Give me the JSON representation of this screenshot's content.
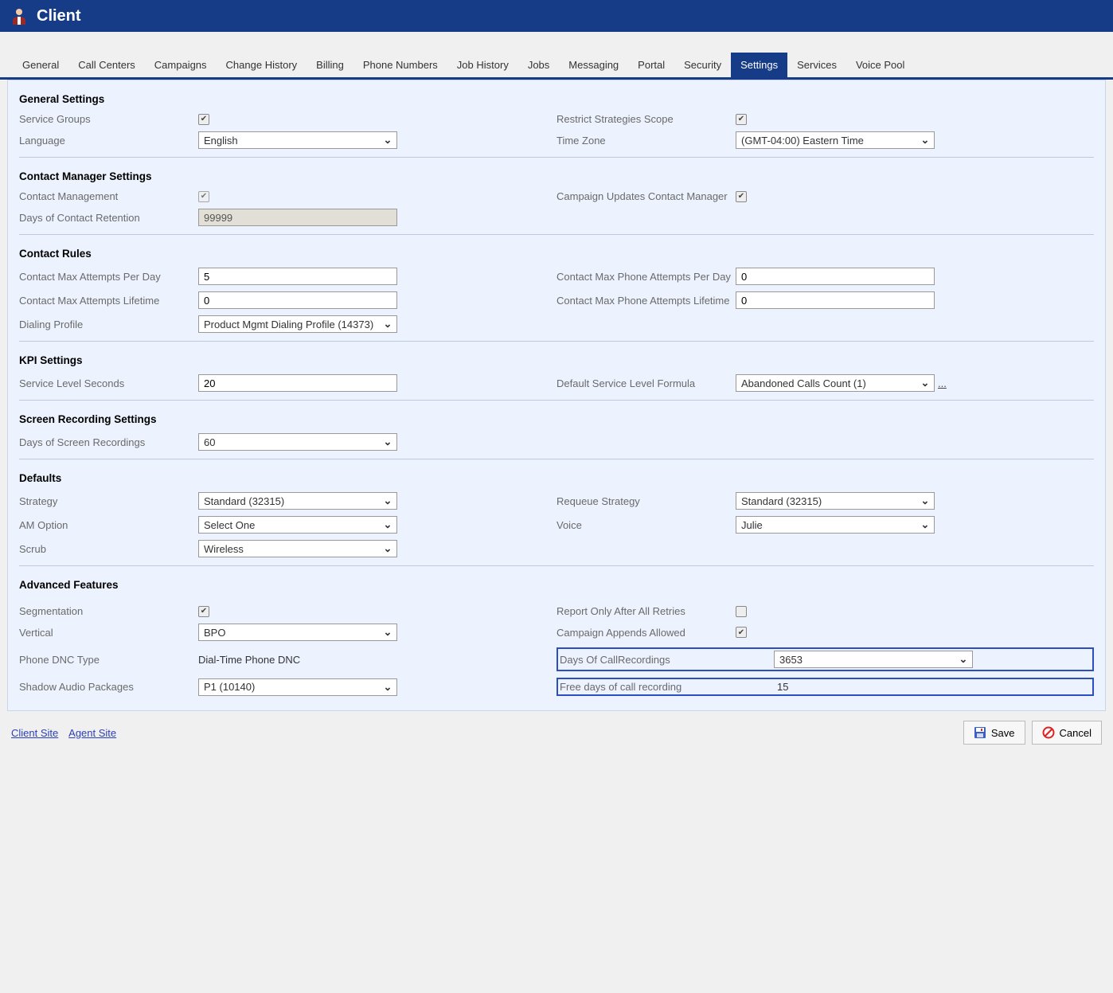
{
  "header": {
    "title": "Client"
  },
  "tabs": [
    "General",
    "Call Centers",
    "Campaigns",
    "Change History",
    "Billing",
    "Phone Numbers",
    "Job History",
    "Jobs",
    "Messaging",
    "Portal",
    "Security",
    "Settings",
    "Services",
    "Voice Pool"
  ],
  "active_tab": "Settings",
  "sections": {
    "general_settings": {
      "title": "General Settings",
      "service_groups_label": "Service Groups",
      "restrict_strategies_label": "Restrict Strategies Scope",
      "language_label": "Language",
      "language_value": "English",
      "timezone_label": "Time Zone",
      "timezone_value": "(GMT-04:00) Eastern Time"
    },
    "contact_manager": {
      "title": "Contact Manager Settings",
      "contact_mgmt_label": "Contact Management",
      "campaign_updates_label": "Campaign Updates Contact Manager",
      "days_retention_label": "Days of Contact Retention",
      "days_retention_value": "99999"
    },
    "contact_rules": {
      "title": "Contact Rules",
      "max_attempts_day_label": "Contact Max Attempts Per Day",
      "max_attempts_day_value": "5",
      "max_phone_attempts_day_label": "Contact Max Phone Attempts Per Day",
      "max_phone_attempts_day_value": "0",
      "max_attempts_life_label": "Contact Max Attempts Lifetime",
      "max_attempts_life_value": "0",
      "max_phone_attempts_life_label": "Contact Max Phone Attempts Lifetime",
      "max_phone_attempts_life_value": "0",
      "dialing_profile_label": "Dialing Profile",
      "dialing_profile_value": "Product Mgmt Dialing Profile (14373)"
    },
    "kpi": {
      "title": "KPI Settings",
      "service_level_label": "Service Level Seconds",
      "service_level_value": "20",
      "default_formula_label": "Default Service Level Formula",
      "default_formula_value": "Abandoned Calls Count (1)"
    },
    "screen_recording": {
      "title": "Screen Recording Settings",
      "days_label": "Days of Screen Recordings",
      "days_value": "60"
    },
    "defaults": {
      "title": "Defaults",
      "strategy_label": "Strategy",
      "strategy_value": "Standard (32315)",
      "requeue_label": "Requeue Strategy",
      "requeue_value": "Standard (32315)",
      "am_option_label": "AM Option",
      "am_option_value": "Select One",
      "voice_label": "Voice",
      "voice_value": "Julie",
      "scrub_label": "Scrub",
      "scrub_value": "Wireless"
    },
    "advanced": {
      "title": "Advanced Features",
      "segmentation_label": "Segmentation",
      "report_only_label": "Report Only After All Retries",
      "vertical_label": "Vertical",
      "vertical_value": "BPO",
      "campaign_appends_label": "Campaign Appends Allowed",
      "phone_dnc_label": "Phone DNC Type",
      "phone_dnc_value": "Dial-Time Phone DNC",
      "days_callrec_label": "Days Of CallRecordings",
      "days_callrec_value": "3653",
      "shadow_audio_label": "Shadow Audio Packages",
      "shadow_audio_value": "P1 (10140)",
      "free_days_label": "Free days of call recording",
      "free_days_value": "15"
    }
  },
  "footer": {
    "client_site": "Client Site",
    "agent_site": "Agent Site",
    "save": "Save",
    "cancel": "Cancel"
  }
}
